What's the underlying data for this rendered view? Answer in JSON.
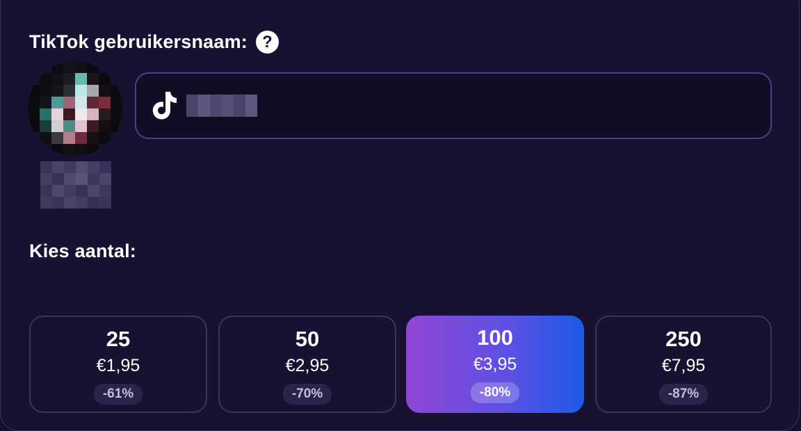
{
  "username_section": {
    "label": "TikTok gebruikersnaam:",
    "help_icon": "?"
  },
  "amount_section": {
    "label": "Kies aantal:"
  },
  "options": [
    {
      "quantity": "25",
      "price": "€1,95",
      "discount": "-61%",
      "selected": false
    },
    {
      "quantity": "50",
      "price": "€2,95",
      "discount": "-70%",
      "selected": false
    },
    {
      "quantity": "100",
      "price": "€3,95",
      "discount": "-80%",
      "selected": true
    },
    {
      "quantity": "250",
      "price": "€7,95",
      "discount": "-87%",
      "selected": false
    }
  ],
  "colors": {
    "background": "#171232",
    "input_background": "#110d25",
    "input_border": "#4b3f8a",
    "option_border": "#3b335e",
    "selected_gradient_start": "#9046d2",
    "selected_gradient_end": "#1c5ae6",
    "text": "#ffffff"
  },
  "icons": {
    "help": "question-circle-icon",
    "input_prefix": "tiktok-logo-icon"
  }
}
